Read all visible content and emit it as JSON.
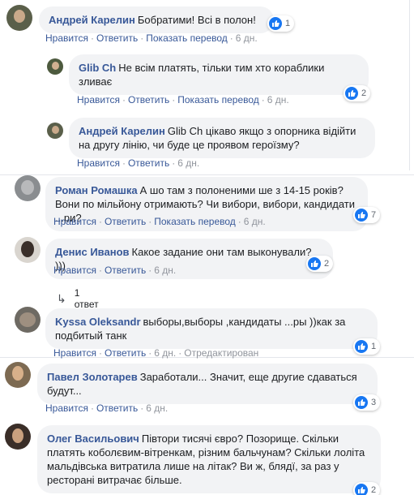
{
  "comments": [
    {
      "author": "Андрей Карелин",
      "text": "Бобратими! Всі в полон!",
      "reactions": "1",
      "actions": {
        "like": "Нравится",
        "reply": "Ответить",
        "translate": "Показать перевод",
        "time": "6 дн."
      }
    },
    {
      "author": "Glib Ch",
      "text": "Не всім платять, тільки тим хто кораблики зливає",
      "reactions": "2",
      "actions": {
        "like": "Нравится",
        "reply": "Ответить",
        "translate": "Показать перевод",
        "time": "6 дн."
      }
    },
    {
      "author": "Андрей Карелин",
      "text": "Glib Ch цікаво якщо з опорника відійти на другу лінію, чи буде це проявом героїзму?",
      "actions": {
        "like": "Нравится",
        "reply": "Ответить",
        "time": "6 дн."
      }
    },
    {
      "author": "Роман Ромашка",
      "text": "А шо там з полоненими ше з 14-15 років? Вони по мільйону отримають? Чи вибори, вибори, кандидати ...ри?",
      "reactions": "7",
      "actions": {
        "like": "Нравится",
        "reply": "Ответить",
        "translate": "Показать перевод",
        "time": "6 дн."
      }
    },
    {
      "author": "Денис Иванов",
      "text": "Какое задание они там выконували? )))",
      "reactions": "2",
      "actions": {
        "like": "Нравится",
        "reply": "Ответить",
        "time": "6 дн."
      },
      "replies": "1 ответ"
    },
    {
      "author": "Kyssa Oleksandr",
      "text": "выборы,выборы ,кандидаты ...ры ))как за подбитый танк",
      "reactions": "1",
      "actions": {
        "like": "Нравится",
        "reply": "Ответить",
        "time": "6 дн.",
        "edited": "Отредактирован"
      }
    },
    {
      "author": "Павел Золотарев",
      "text": "Заработали... Значит, еще другие сдаваться будут...",
      "reactions": "3",
      "actions": {
        "like": "Нравится",
        "reply": "Ответить",
        "time": "6 дн."
      }
    },
    {
      "author": "Олег Васильович",
      "text": "Півтори тисячі євро? Позорище. Скільки платять коболєвим-вітренкам, різним бальчунам? Скільки лоліта мальдівська витратила лише на літак? Ви ж, блядї, за раз у ресторані витрачає більше.",
      "reactions": "2"
    }
  ],
  "colors": {
    "link": "#385898",
    "bubble": "#f2f3f5",
    "like": "#1877f2"
  }
}
